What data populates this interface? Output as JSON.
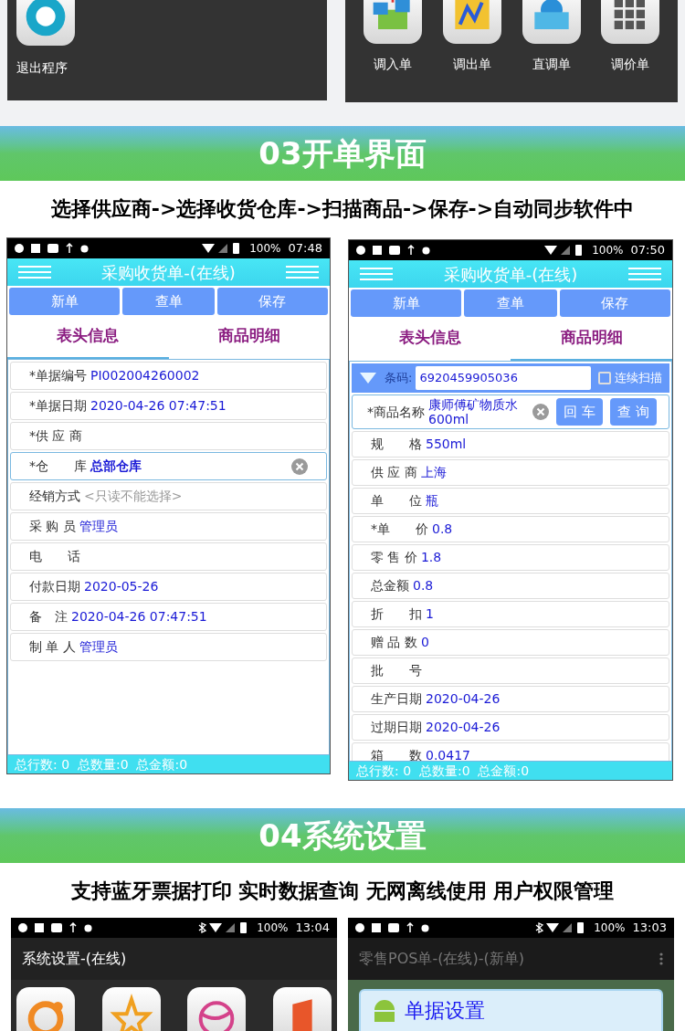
{
  "top_panels": {
    "left": {
      "apps": [
        {
          "label": "退出程序"
        }
      ]
    },
    "right": {
      "apps": [
        {
          "label": "调入单"
        },
        {
          "label": "调出单"
        },
        {
          "label": "直调单"
        },
        {
          "label": "调价单"
        }
      ]
    }
  },
  "sections": [
    {
      "banner": "03开单界面",
      "subtitle": "选择供应商->选择收货仓库->扫描商品->保存->自动同步软件中"
    },
    {
      "banner": "04系统设置",
      "subtitle": "支持蓝牙票据打印 实时数据查询 无网离线使用 用户权限管理"
    }
  ],
  "order_phones": [
    {
      "status": {
        "battery": "100%",
        "time": "07:48"
      },
      "title": "采购收货单-(在线)",
      "buttons": [
        "新单",
        "查单",
        "保存"
      ],
      "tabs": [
        {
          "label": "表头信息",
          "selected": true
        },
        {
          "label": "商品明细",
          "selected": false
        }
      ],
      "fields": [
        {
          "label": "*单据编号",
          "value": "PI002004260002",
          "kind": "value",
          "selected": false
        },
        {
          "label": "*单据日期",
          "value": "2020-04-26 07:47:51",
          "kind": "value",
          "selected": false
        },
        {
          "label": "*供 应 商",
          "kind": "empty",
          "selected": false
        },
        {
          "label": "*仓　　库",
          "value": "总部仓库",
          "kind": "clearable",
          "selected": true
        },
        {
          "label": "经销方式",
          "placeholder": "<只读不能选择>",
          "kind": "hint",
          "selected": false
        },
        {
          "label": "采 购 员",
          "value": "管理员",
          "kind": "value",
          "selected": false
        },
        {
          "label": "电　　话",
          "kind": "empty",
          "selected": false
        },
        {
          "label": "付款日期",
          "value": "2020-05-26",
          "kind": "value",
          "selected": false
        },
        {
          "label": "备　注",
          "value": "2020-04-26 07:47:51",
          "kind": "value",
          "selected": false
        },
        {
          "label": "制 单 人",
          "value": "管理员",
          "kind": "value",
          "selected": false
        }
      ],
      "footer": "总行数: 0  总数量:0  总金额:0"
    },
    {
      "status": {
        "battery": "100%",
        "time": "07:50"
      },
      "title": "采购收货单-(在线)",
      "buttons": [
        "新单",
        "查单",
        "保存"
      ],
      "tabs": [
        {
          "label": "表头信息",
          "selected": false
        },
        {
          "label": "商品明细",
          "selected": true
        }
      ],
      "barcode": {
        "label": "条码:",
        "value": "6920459905036",
        "checkbox": {
          "label": "连续扫描",
          "checked": false
        }
      },
      "product": {
        "label": "*商品名称",
        "value": "康师傅矿物质水600ml",
        "buttons": [
          "回 车",
          "查 询"
        ],
        "selected": true
      },
      "fields": [
        {
          "label": "规　　格",
          "value": "550ml",
          "kind": "value",
          "selected": false
        },
        {
          "label": "供 应 商",
          "value": "上海",
          "kind": "value",
          "selected": false
        },
        {
          "label": "单　　位",
          "value": "瓶",
          "kind": "value",
          "selected": false
        },
        {
          "label": "*单　　价",
          "value": "0.8",
          "kind": "value",
          "selected": false
        },
        {
          "label": "零 售 价",
          "value": "1.8",
          "kind": "value",
          "selected": false
        },
        {
          "label": "总金额",
          "value": "0.8",
          "kind": "value",
          "selected": false
        },
        {
          "label": "折　　扣",
          "value": "1",
          "kind": "value",
          "selected": false
        },
        {
          "label": "赠 品 数",
          "value": "0",
          "kind": "value",
          "selected": false
        },
        {
          "label": "批　　号",
          "kind": "empty",
          "selected": false
        },
        {
          "label": "生产日期",
          "value": "2020-04-26",
          "kind": "value",
          "selected": false
        },
        {
          "label": "过期日期",
          "value": "2020-04-26",
          "kind": "value",
          "selected": false
        },
        {
          "label": "箱　　数",
          "value": "0.0417",
          "kind": "value",
          "selected": false
        }
      ],
      "footer": "总行数: 0  总数量:0  总金额:0"
    }
  ],
  "settings_phones": [
    {
      "status": {
        "battery": "100%",
        "time": "13:04"
      },
      "title": "系统设置-(在线)",
      "kind": "apps"
    },
    {
      "status": {
        "battery": "100%",
        "time": "13:03"
      },
      "title": "零售POS单-(在线)-(新单)",
      "kind": "dialog",
      "dialog_title": "单据设置"
    }
  ]
}
